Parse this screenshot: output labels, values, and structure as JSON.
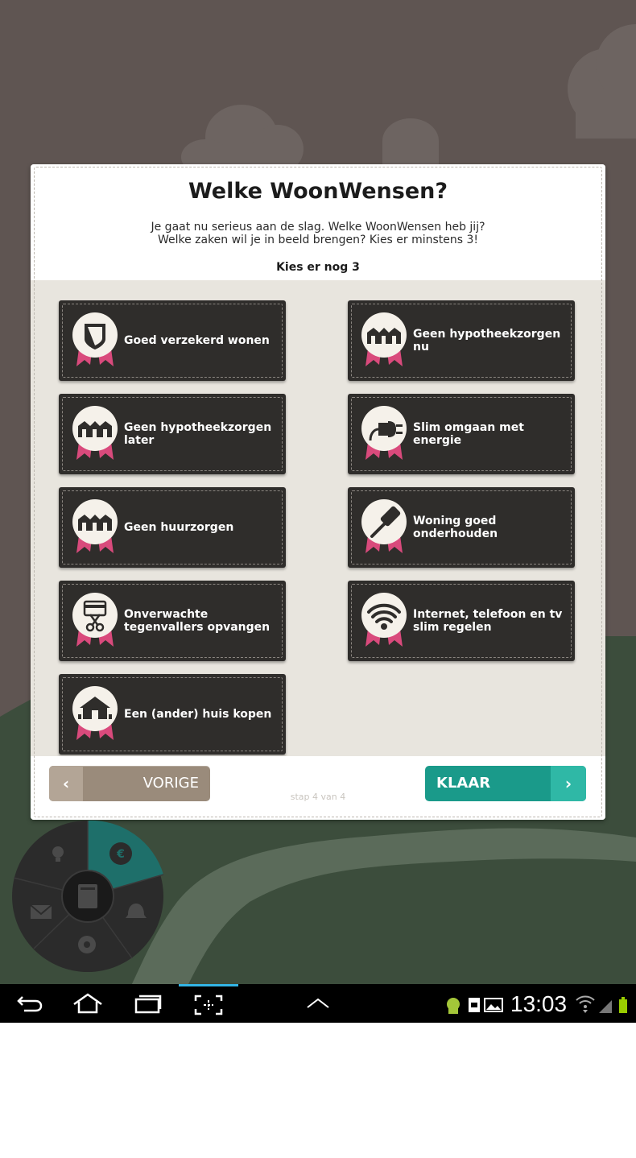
{
  "modal": {
    "title": "Welke WoonWensen?",
    "description_line1": "Je gaat nu serieus aan de slag. Welke WoonWensen heb jij?",
    "description_line2": "Welke zaken wil je in beeld brengen? Kies er minstens 3!",
    "counter": "Kies er nog 3"
  },
  "tiles": [
    {
      "label": "Goed verzekerd wonen",
      "icon": "shield-icon"
    },
    {
      "label": "Geen hypotheekzorgen nu",
      "icon": "houses-icon"
    },
    {
      "label": "Geen hypotheekzorgen later",
      "icon": "houses-icon"
    },
    {
      "label": "Slim omgaan met energie",
      "icon": "plug-icon"
    },
    {
      "label": "Geen huurzorgen",
      "icon": "houses-icon"
    },
    {
      "label": "Woning goed onderhouden",
      "icon": "paint-roller-icon"
    },
    {
      "label": "Onverwachte tegenvallers opvangen",
      "icon": "card-scissors-icon"
    },
    {
      "label": "Internet, telefoon en tv slim regelen",
      "icon": "wifi-icon"
    },
    {
      "label": "Een (ander) huis kopen",
      "icon": "house-icon"
    }
  ],
  "footer": {
    "prev_label": "VORIGE",
    "step_label": "stap 4 van 4",
    "next_label": "KLAAR"
  },
  "radial_menu": {
    "items": [
      "lightbulb-icon",
      "euro-bag-icon",
      "bell-icon",
      "gear-icon",
      "mail-icon",
      "notebook-icon"
    ]
  },
  "system_bar": {
    "time": "13:03",
    "nav_icons": [
      "back-icon",
      "home-icon",
      "recent-apps-icon",
      "screenshot-icon",
      "up-chevron-icon"
    ],
    "status_icons": [
      "android-icon",
      "sim-icon",
      "image-icon",
      "wifi-icon",
      "signal-icon",
      "battery-icon"
    ]
  },
  "colors": {
    "sky": "#5f5552",
    "hill": "#3c4d3c",
    "tile": "#2f2d2b",
    "accent_teal": "#1a9a8a",
    "ribbon_pink": "#d94a7c",
    "prev_button": "#9a8b7b"
  }
}
